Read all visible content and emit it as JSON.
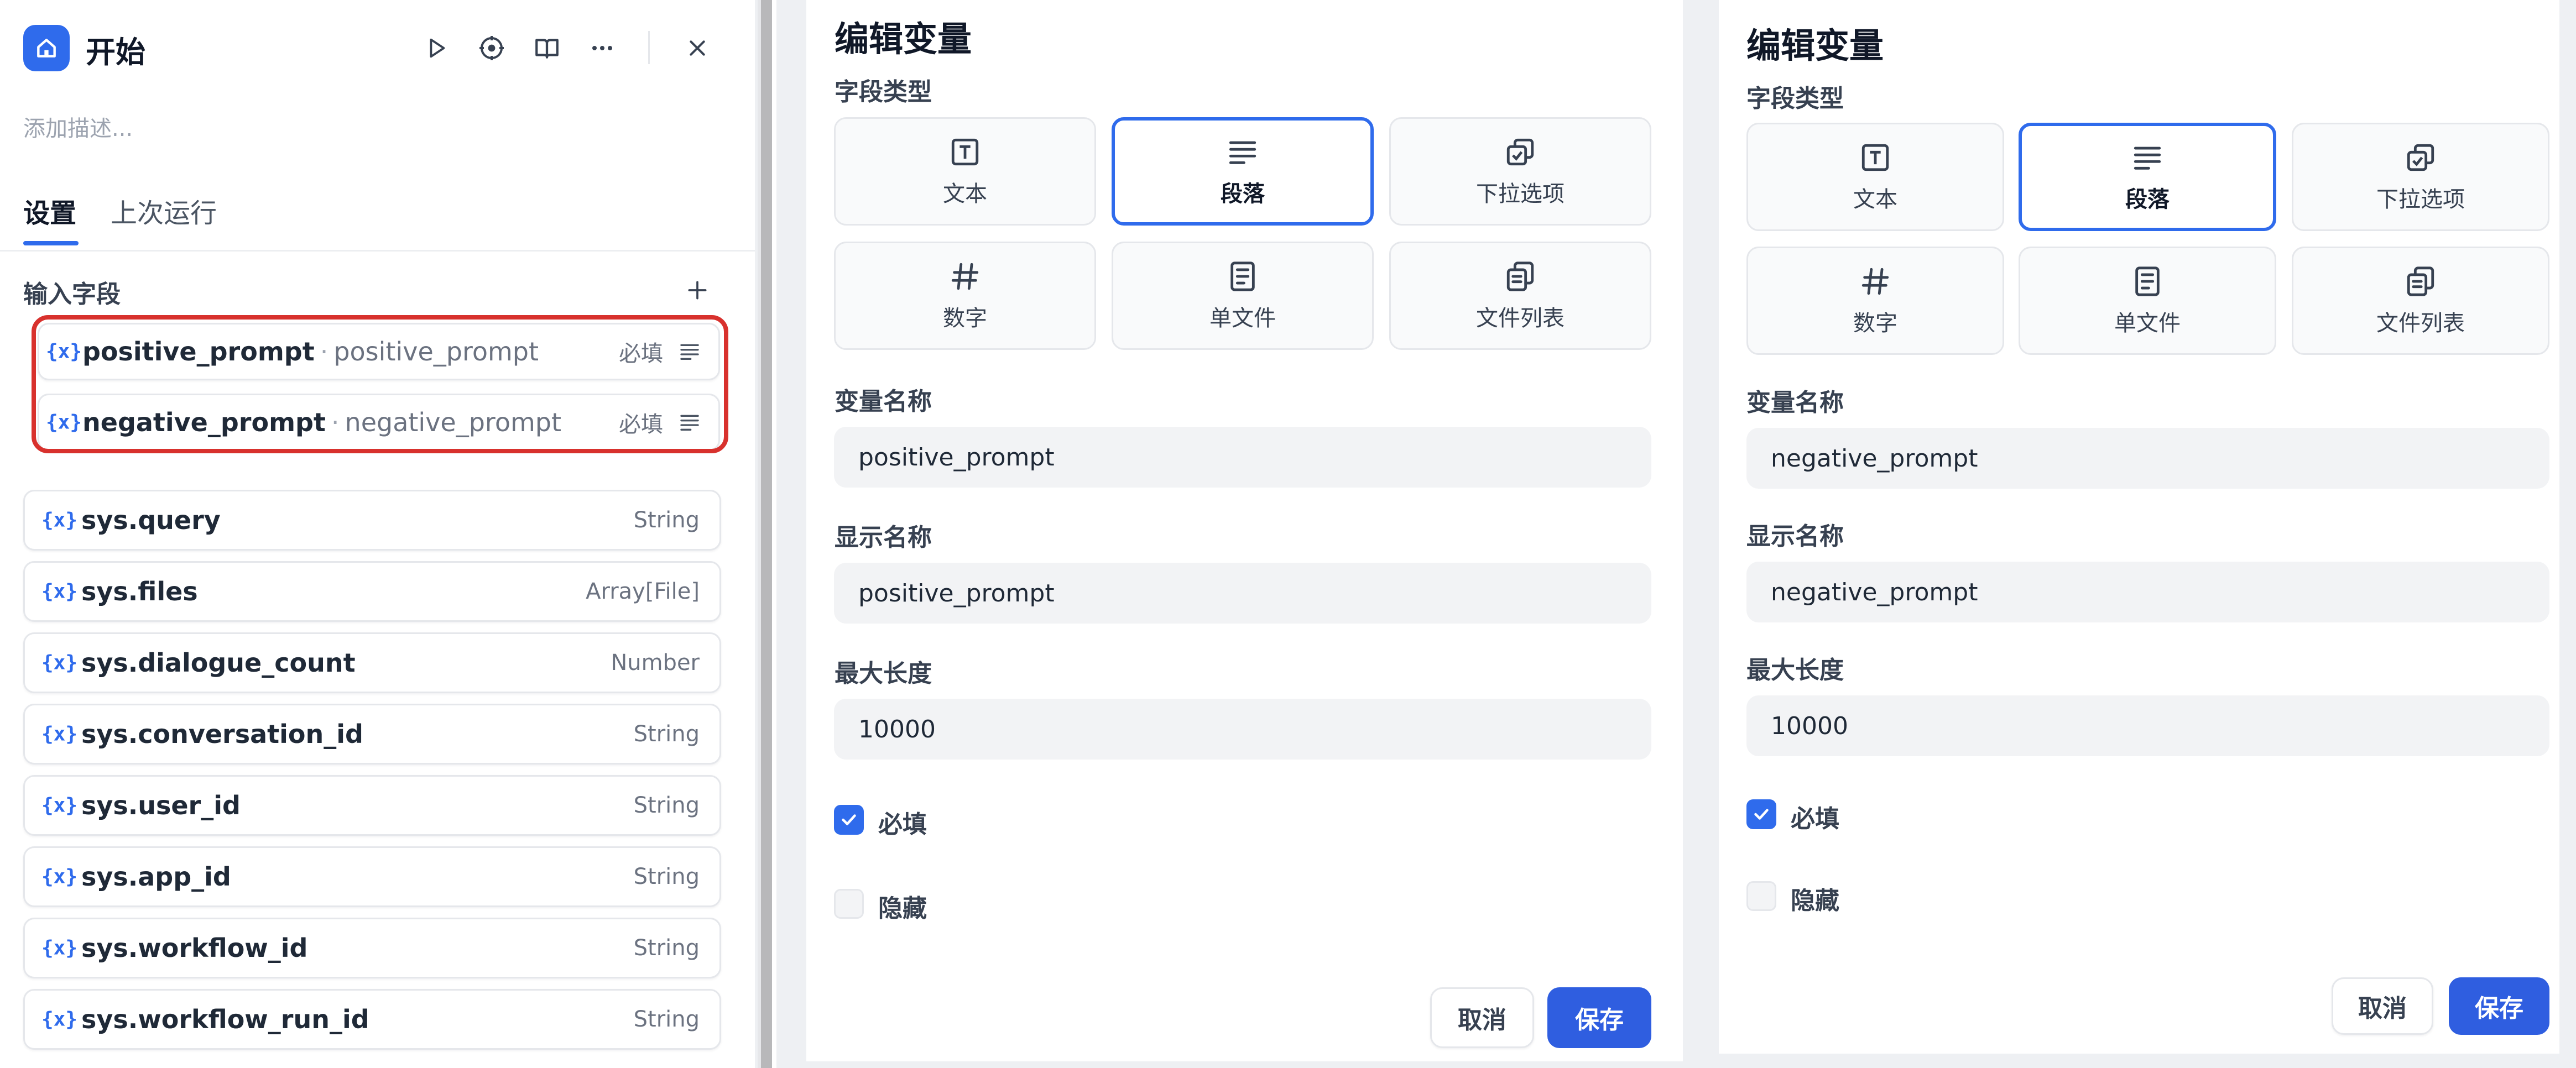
{
  "node": {
    "title": "开始",
    "description_placeholder": "添加描述...",
    "tabs": [
      {
        "label": "设置"
      },
      {
        "label": "上次运行"
      }
    ],
    "input_section_title": "输入字段",
    "input_fields": [
      {
        "name": "positive_prompt",
        "label": "positive_prompt",
        "required": "必填"
      },
      {
        "name": "negative_prompt",
        "label": "negative_prompt",
        "required": "必填"
      }
    ],
    "system_vars": [
      {
        "name": "sys.query",
        "type": "String"
      },
      {
        "name": "sys.files",
        "type": "Array[File]"
      },
      {
        "name": "sys.dialogue_count",
        "type": "Number"
      },
      {
        "name": "sys.conversation_id",
        "type": "String"
      },
      {
        "name": "sys.user_id",
        "type": "String"
      },
      {
        "name": "sys.app_id",
        "type": "String"
      },
      {
        "name": "sys.workflow_id",
        "type": "String"
      },
      {
        "name": "sys.workflow_run_id",
        "type": "String"
      }
    ],
    "var_icon": "{x}"
  },
  "modals": [
    {
      "title": "编辑变量",
      "field_type_label": "字段类型",
      "field_types": [
        {
          "label": "文本",
          "icon": "text-icon"
        },
        {
          "label": "段落",
          "icon": "paragraph-icon"
        },
        {
          "label": "下拉选项",
          "icon": "select-icon"
        },
        {
          "label": "数字",
          "icon": "number-icon"
        },
        {
          "label": "单文件",
          "icon": "file-icon"
        },
        {
          "label": "文件列表",
          "icon": "file-list-icon"
        }
      ],
      "selected_type": "段落",
      "var_name_label": "变量名称",
      "var_name_value": "positive_prompt",
      "display_name_label": "显示名称",
      "display_name_value": "positive_prompt",
      "max_length_label": "最大长度",
      "max_length_value": "10000",
      "required_label": "必填",
      "required_checked": true,
      "hidden_label": "隐藏",
      "hidden_checked": false,
      "cancel_label": "取消",
      "save_label": "保存"
    },
    {
      "title": "编辑变量",
      "field_type_label": "字段类型",
      "field_types": [
        {
          "label": "文本",
          "icon": "text-icon"
        },
        {
          "label": "段落",
          "icon": "paragraph-icon"
        },
        {
          "label": "下拉选项",
          "icon": "select-icon"
        },
        {
          "label": "数字",
          "icon": "number-icon"
        },
        {
          "label": "单文件",
          "icon": "file-icon"
        },
        {
          "label": "文件列表",
          "icon": "file-list-icon"
        }
      ],
      "selected_type": "段落",
      "var_name_label": "变量名称",
      "var_name_value": "negative_prompt",
      "display_name_label": "显示名称",
      "display_name_value": "negative_prompt",
      "max_length_label": "最大长度",
      "max_length_value": "10000",
      "required_label": "必填",
      "required_checked": true,
      "hidden_label": "隐藏",
      "hidden_checked": false,
      "cancel_label": "取消",
      "save_label": "保存"
    }
  ],
  "colors": {
    "accent": "#2f6bec",
    "highlight": "#d8312d"
  }
}
